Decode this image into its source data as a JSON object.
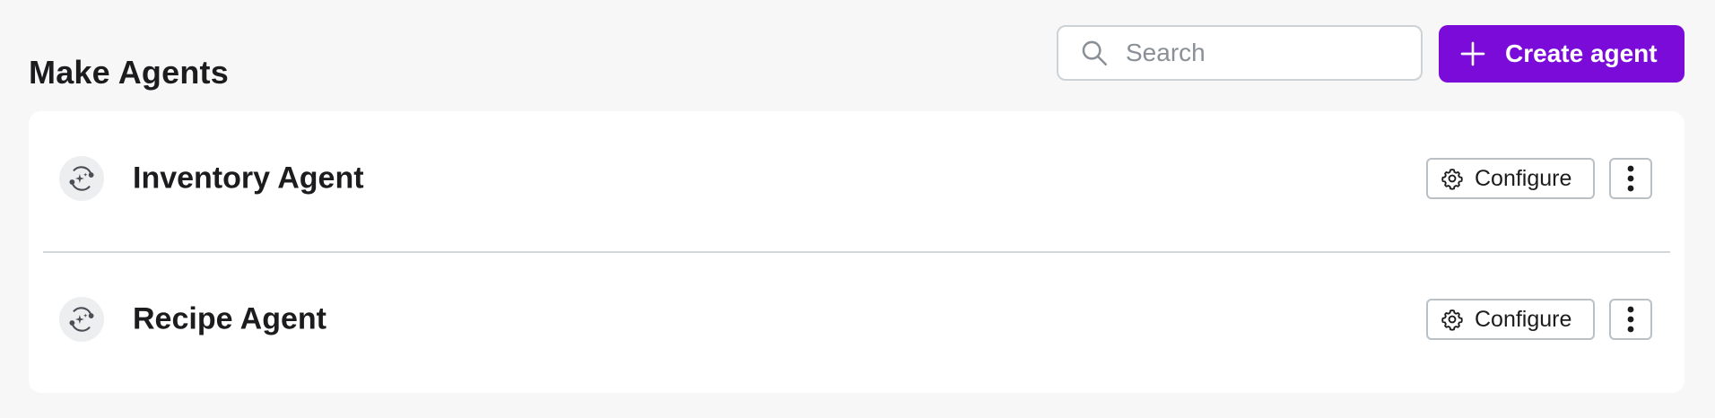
{
  "header": {
    "title": "Make Agents",
    "search": {
      "placeholder": "Search",
      "value": ""
    },
    "create_button": {
      "label": "Create agent",
      "icon": "plus-icon"
    }
  },
  "agents": [
    {
      "name": "Inventory Agent",
      "icon": "agent-sparkle-icon",
      "configure_label": "Configure",
      "more_icon": "more-vertical-icon"
    },
    {
      "name": "Recipe Agent",
      "icon": "agent-sparkle-icon",
      "configure_label": "Configure",
      "more_icon": "more-vertical-icon"
    }
  ],
  "colors": {
    "background": "#f7f7f7",
    "accent": "#7a0bd8",
    "card": "#ffffff",
    "border": "#b9c0c6"
  }
}
